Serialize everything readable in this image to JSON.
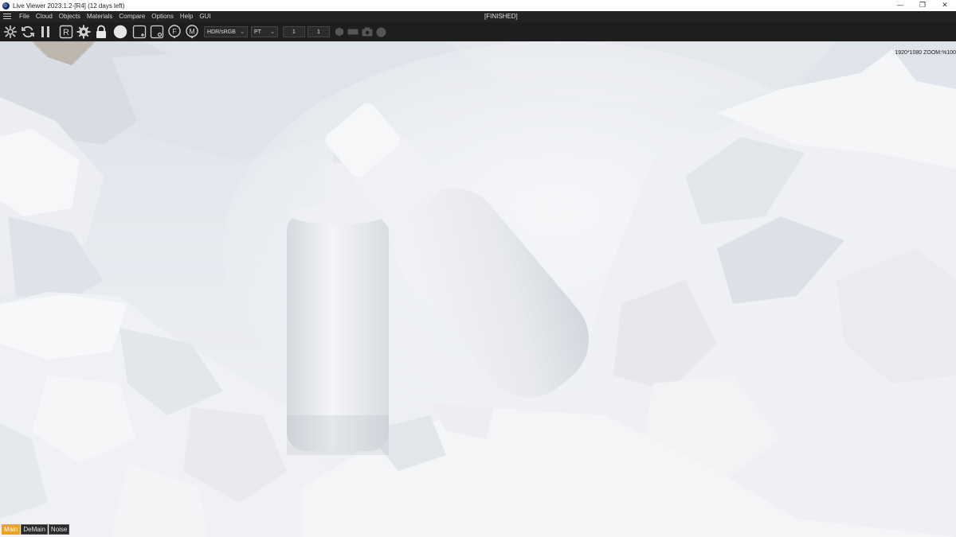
{
  "window": {
    "title": "Live Viewer 2023.1.2-[R4] (12 days left)",
    "controls": {
      "minimize": "—",
      "maximize": "❐",
      "close": "✕"
    }
  },
  "menu": {
    "items": [
      "File",
      "Cloud",
      "Objects",
      "Materials",
      "Compare",
      "Options",
      "Help",
      "GUI"
    ],
    "status": "[FINISHED]"
  },
  "toolbar": {
    "icons": [
      "settings-wheel-icon",
      "refresh-icon",
      "pause-icon",
      "region-render-icon",
      "gear-icon",
      "lock-icon",
      "sphere-icon",
      "add-layer-icon",
      "focus-icon",
      "f-pick-icon",
      "m-pick-icon"
    ],
    "r_label": "R",
    "f_label": "F",
    "m_label": "M",
    "color_space": "HDR/sRGB",
    "kernel": "PT",
    "field_1": "1",
    "field_2": "1"
  },
  "viewport": {
    "info": "1920*1080 ZOOM:%100"
  },
  "channels": {
    "tabs": [
      "Main",
      "DeMain",
      "Noise"
    ],
    "active": "Main"
  },
  "colors": {
    "accent": "#f0a21a",
    "menubar": "#232323",
    "toolbar": "#1e1e1e"
  }
}
